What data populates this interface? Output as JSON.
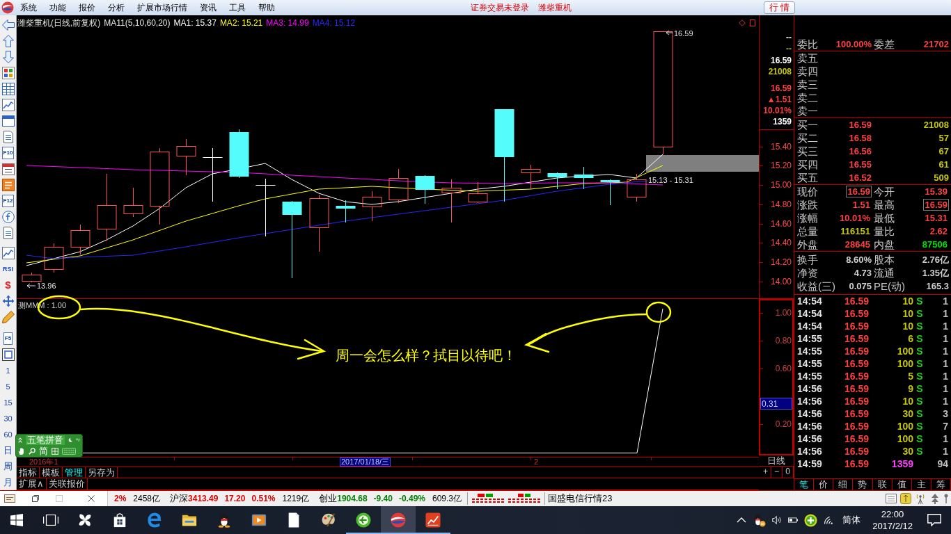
{
  "menu_bar": {
    "items": [
      "系统",
      "功能",
      "报价",
      "分析",
      "扩展市场行情",
      "资讯",
      "工具",
      "帮助"
    ],
    "status": [
      "证券交易未登录",
      "潍柴重机"
    ],
    "quote_button": "行 情"
  },
  "left_toolbar": {
    "labels": [
      "F10",
      "F12",
      "RSI",
      "$",
      "F5",
      "1",
      "5",
      "15",
      "30",
      "60",
      "日",
      "周",
      "月"
    ]
  },
  "chart_header": {
    "title": "潍柴重机(日线,前复权)",
    "formula": "MA11(5,10,60,20)",
    "averages": [
      {
        "label": "MA1: 15.37",
        "color": "#ffffff"
      },
      {
        "label": "MA2: 15.21",
        "color": "#ffff00"
      },
      {
        "label": "MA3: 14.99",
        "color": "#ff00ff"
      },
      {
        "label": "MA4: 15.12",
        "color": "#2828ff"
      }
    ]
  },
  "price_chart": {
    "high_label": "16.59",
    "low_label": "13.96",
    "range_label": "15.13 - 15.31"
  },
  "price_axis": {
    "quote": [
      {
        "text": "--",
        "color": "#ffffff"
      },
      {
        "text": "--",
        "color": "#b0b040"
      },
      {
        "text": "16.59",
        "color": "#ffffff"
      },
      {
        "text": "21008",
        "color": "#c8c800"
      },
      {
        "text": "16.59",
        "color": "#ff4040"
      },
      {
        "text": "▲1.51",
        "color": "#ff4040"
      },
      {
        "text": "10.01%",
        "color": "#ff4040"
      },
      {
        "text": "1359",
        "color": "#ffffff"
      }
    ],
    "ticks": [
      "15.40",
      "15.20",
      "15.00",
      "14.80",
      "14.60",
      "14.40",
      "14.20",
      "14.00"
    ]
  },
  "indicator": {
    "label": "测MMM : 1.00",
    "ticks": [
      "1.00",
      "0.80",
      "0.60",
      "0.20"
    ],
    "current": "0.31"
  },
  "annotation": {
    "text": "周一会怎么样？拭目以待吧！"
  },
  "date_bar": {
    "labels": [
      {
        "text": "2016年1",
        "selected": false
      },
      {
        "text": "2017/01/18/三",
        "selected": true
      },
      {
        "text": "2",
        "selected": false
      }
    ],
    "period": "日线",
    "zoom_buttons": [
      "+",
      "−",
      "0"
    ]
  },
  "view_tabs": [
    {
      "label": "指标",
      "selected": false
    },
    {
      "label": "模板",
      "selected": false
    },
    {
      "label": "管理",
      "selected": true
    },
    {
      "label": "另存为",
      "selected": false
    }
  ],
  "extra_tabs": [
    "扩展∧",
    "关联报价"
  ],
  "order_book": {
    "ratio": [
      {
        "label": "委比",
        "value": "100.00%"
      },
      {
        "label": "委差",
        "value": "21702"
      }
    ],
    "asks": [
      "卖五",
      "卖四",
      "卖三",
      "卖二",
      "卖一"
    ],
    "bids": [
      {
        "label": "买一",
        "price": "16.59",
        "volume": "21008"
      },
      {
        "label": "买二",
        "price": "16.58",
        "volume": "57"
      },
      {
        "label": "买三",
        "price": "16.56",
        "volume": "67"
      },
      {
        "label": "买四",
        "price": "16.55",
        "volume": "61"
      },
      {
        "label": "买五",
        "price": "16.52",
        "volume": "509"
      }
    ]
  },
  "quote_stats": [
    {
      "label": "现价",
      "value": "16.59",
      "color": "#ff4040",
      "boxed": true
    },
    {
      "label": "今开",
      "value": "15.39",
      "color": "#ff4040",
      "boxed": false
    },
    {
      "label": "涨跌",
      "value": "1.51",
      "color": "#ff4040",
      "boxed": false
    },
    {
      "label": "最高",
      "value": "16.59",
      "color": "#ff4040",
      "boxed": true
    },
    {
      "label": "涨幅",
      "value": "10.01%",
      "color": "#ff4040",
      "boxed": false
    },
    {
      "label": "最低",
      "value": "15.31",
      "color": "#ff4040",
      "boxed": false
    },
    {
      "label": "总量",
      "value": "116151",
      "color": "#c8c800",
      "boxed": false
    },
    {
      "label": "量比",
      "value": "2.62",
      "color": "#ff4040",
      "boxed": false
    },
    {
      "label": "外盘",
      "value": "28645",
      "color": "#ff4040",
      "boxed": false
    },
    {
      "label": "内盘",
      "value": "87506",
      "color": "#00e000",
      "boxed": false
    }
  ],
  "fundamentals": [
    {
      "label": "换手",
      "value": "8.60%"
    },
    {
      "label": "股本",
      "value": "2.76亿"
    },
    {
      "label": "净资",
      "value": "4.73"
    },
    {
      "label": "流通",
      "value": "1.35亿"
    },
    {
      "label": "收益(三)",
      "value": "0.075"
    },
    {
      "label": "PE(动)",
      "value": "165.3"
    }
  ],
  "trades": [
    {
      "kind": "tick",
      "time": "14:54",
      "price": "16.59",
      "volume": "10",
      "side": "S",
      "count": "1"
    },
    {
      "kind": "tick",
      "time": "14:54",
      "price": "16.59",
      "volume": "10",
      "side": "S",
      "count": "1"
    },
    {
      "kind": "tick",
      "time": "14:54",
      "price": "16.59",
      "volume": "10",
      "side": "S",
      "count": "1"
    },
    {
      "kind": "tick",
      "time": "14:55",
      "price": "16.59",
      "volume": "6",
      "side": "S",
      "count": "1"
    },
    {
      "kind": "tick",
      "time": "14:55",
      "price": "16.59",
      "volume": "100",
      "side": "S",
      "count": "1"
    },
    {
      "kind": "tick",
      "time": "14:55",
      "price": "16.59",
      "volume": "100",
      "side": "S",
      "count": "1"
    },
    {
      "kind": "tick",
      "time": "14:55",
      "price": "16.59",
      "volume": "5",
      "side": "S",
      "count": "1"
    },
    {
      "kind": "tick",
      "time": "14:56",
      "price": "16.59",
      "volume": "9",
      "side": "S",
      "count": "1"
    },
    {
      "kind": "tick",
      "time": "14:56",
      "price": "16.59",
      "volume": "10",
      "side": "S",
      "count": "1"
    },
    {
      "kind": "tick",
      "time": "14:56",
      "price": "16.59",
      "volume": "30",
      "side": "S",
      "count": "3"
    },
    {
      "kind": "tick",
      "time": "14:56",
      "price": "16.59",
      "volume": "100",
      "side": "S",
      "count": "7"
    },
    {
      "kind": "tick",
      "time": "14:56",
      "price": "16.59",
      "volume": "100",
      "side": "S",
      "count": "1"
    },
    {
      "kind": "tick",
      "time": "14:56",
      "price": "16.59",
      "volume": "30",
      "side": "S",
      "count": "1"
    },
    {
      "kind": "total",
      "time": "14:59",
      "price": "16.59",
      "volume": "1359",
      "count": "94"
    }
  ],
  "panel_tabs": [
    {
      "label": "笔",
      "selected": true
    },
    {
      "label": "价",
      "selected": false
    },
    {
      "label": "细",
      "selected": false
    },
    {
      "label": "势",
      "selected": false
    },
    {
      "label": "联",
      "selected": false
    },
    {
      "label": "值",
      "selected": false
    },
    {
      "label": "主",
      "selected": false
    },
    {
      "label": "筹",
      "selected": false
    }
  ],
  "status_bar": {
    "partial": {
      "percent": "2%",
      "amount": "2458亿",
      "color": "#e00000"
    },
    "indices": [
      {
        "name": "沪深",
        "value": "3413.49",
        "change": "17.20",
        "percent": "0.51%",
        "amount": "1219亿",
        "color": "#e00000"
      },
      {
        "name": "创业",
        "value": "1904.68",
        "change": "-9.40",
        "percent": "-0.49%",
        "amount": "609.3亿",
        "color": "#008000"
      }
    ],
    "ticker": "国盛电信行情23"
  },
  "ime_toolbar": {
    "mode": "五笔拼音",
    "charset": "简"
  },
  "taskbar": {
    "apps": [
      {
        "running": false,
        "selected": false
      },
      {
        "running": false,
        "selected": false
      },
      {
        "running": false,
        "selected": false
      },
      {
        "running": false,
        "selected": false
      },
      {
        "running": false,
        "selected": false
      },
      {
        "running": false,
        "selected": false
      },
      {
        "running": false,
        "selected": false
      },
      {
        "running": false,
        "selected": false
      },
      {
        "running": true,
        "selected": false
      },
      {
        "running": true,
        "selected": true
      },
      {
        "running": true,
        "selected": false
      }
    ],
    "ime": "简体",
    "time": "22:00",
    "date": "2017/2/12"
  }
}
